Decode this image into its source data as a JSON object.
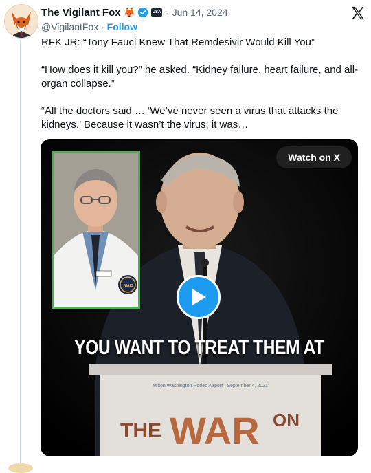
{
  "author": {
    "name": "The Vigilant Fox",
    "emoji": "🦊",
    "flag_text": "USA",
    "handle": "@VigilantFox",
    "follow_label": "Follow",
    "date": "Jun 14, 2024"
  },
  "tweet": {
    "paragraphs": [
      "RFK JR: “Tony Fauci Knew That Remdesivir Would Kill You”",
      "“How does it kill you?” he asked. “Kidney failure, heart failure, and all-organ collapse.”",
      "“All the doctors said … ‘We’ve never seen a virus that attacks the kidneys.’ Because it wasn’t the virus; it was…"
    ]
  },
  "video": {
    "watch_label": "Watch on X",
    "caption": "YOU WANT TO TREAT THEM AT",
    "podium_small_text": "Milton Washington Rodeo Airport · September 4, 2021",
    "podium_logo": "THE WAR ON",
    "badge_text": "NIAID"
  },
  "colors": {
    "accent": "#1d9bf0",
    "inset_border": "#4caf50",
    "podium_logo": "#b8683e"
  },
  "icons": {
    "verified": "verified-badge-icon",
    "x_logo": "x-logo-icon",
    "play": "play-icon"
  }
}
